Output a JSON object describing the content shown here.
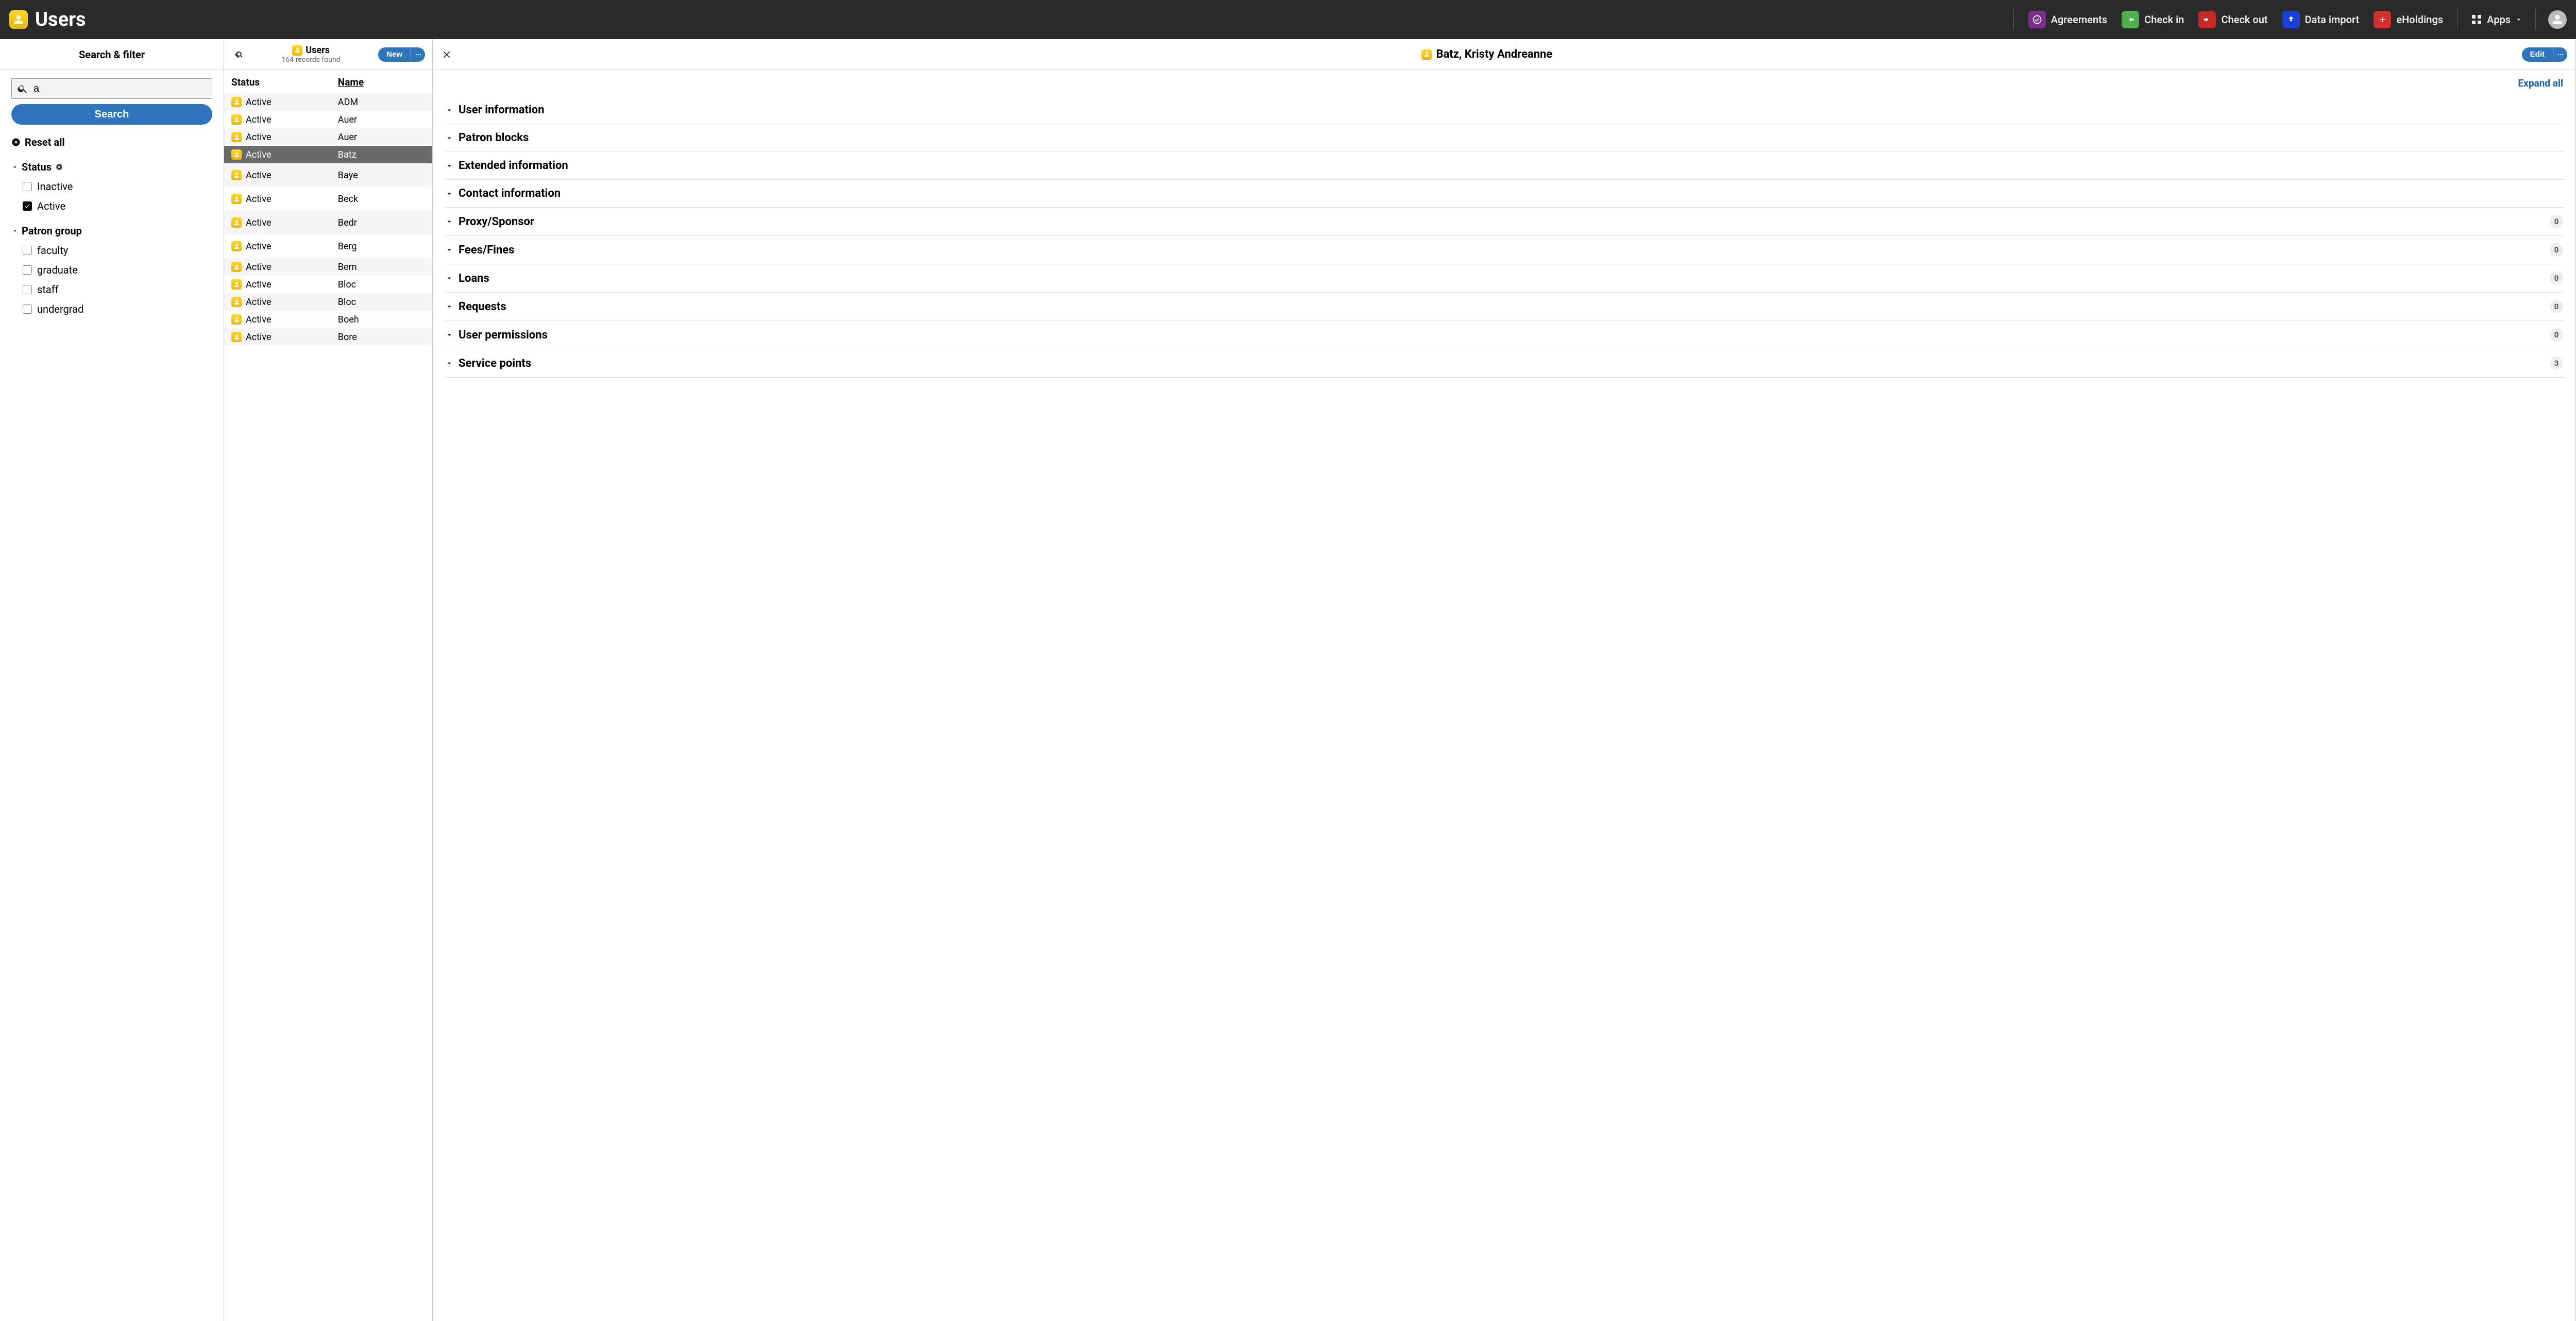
{
  "app": {
    "title": "Users"
  },
  "topnav": {
    "agreements": "Agreements",
    "checkin": "Check in",
    "checkout": "Check out",
    "dataimport": "Data import",
    "eholdings": "eHoldings",
    "apps": "Apps"
  },
  "filter": {
    "header": "Search & filter",
    "search_value": "a",
    "search_button": "Search",
    "reset_all": "Reset all",
    "status_label": "Status",
    "status_options": [
      {
        "label": "Inactive",
        "checked": false
      },
      {
        "label": "Active",
        "checked": true
      }
    ],
    "patron_group_label": "Patron group",
    "patron_group_options": [
      {
        "label": "faculty",
        "checked": false
      },
      {
        "label": "graduate",
        "checked": false
      },
      {
        "label": "staff",
        "checked": false
      },
      {
        "label": "undergrad",
        "checked": false
      }
    ]
  },
  "results": {
    "title": "Users",
    "subtitle": "164 records found",
    "new_button": "New",
    "columns": {
      "status": "Status",
      "name": "Name"
    },
    "rows": [
      {
        "status": "Active",
        "name": "ADM",
        "selected": false,
        "tall": false
      },
      {
        "status": "Active",
        "name": "Auer",
        "selected": false,
        "tall": false
      },
      {
        "status": "Active",
        "name": "Auer",
        "selected": false,
        "tall": false
      },
      {
        "status": "Active",
        "name": "Batz",
        "selected": true,
        "tall": false
      },
      {
        "status": "Active",
        "name": "Baye",
        "selected": false,
        "tall": true
      },
      {
        "status": "Active",
        "name": "Beck",
        "selected": false,
        "tall": true
      },
      {
        "status": "Active",
        "name": "Bedr",
        "selected": false,
        "tall": true
      },
      {
        "status": "Active",
        "name": "Berg",
        "selected": false,
        "tall": true
      },
      {
        "status": "Active",
        "name": "Bern",
        "selected": false,
        "tall": false
      },
      {
        "status": "Active",
        "name": "Bloc",
        "selected": false,
        "tall": false
      },
      {
        "status": "Active",
        "name": "Bloc",
        "selected": false,
        "tall": false
      },
      {
        "status": "Active",
        "name": "Boeh",
        "selected": false,
        "tall": false
      },
      {
        "status": "Active",
        "name": "Bore",
        "selected": false,
        "tall": false
      }
    ]
  },
  "detail": {
    "title": "Batz, Kristy Andreanne",
    "edit_button": "Edit",
    "expand_all": "Expand all",
    "sections": [
      {
        "label": "User information",
        "badge": null
      },
      {
        "label": "Patron blocks",
        "badge": null
      },
      {
        "label": "Extended information",
        "badge": null
      },
      {
        "label": "Contact information",
        "badge": null
      },
      {
        "label": "Proxy/Sponsor",
        "badge": "0"
      },
      {
        "label": "Fees/Fines",
        "badge": "0"
      },
      {
        "label": "Loans",
        "badge": "0"
      },
      {
        "label": "Requests",
        "badge": "0"
      },
      {
        "label": "User permissions",
        "badge": "0"
      },
      {
        "label": "Service points",
        "badge": "3"
      }
    ]
  }
}
